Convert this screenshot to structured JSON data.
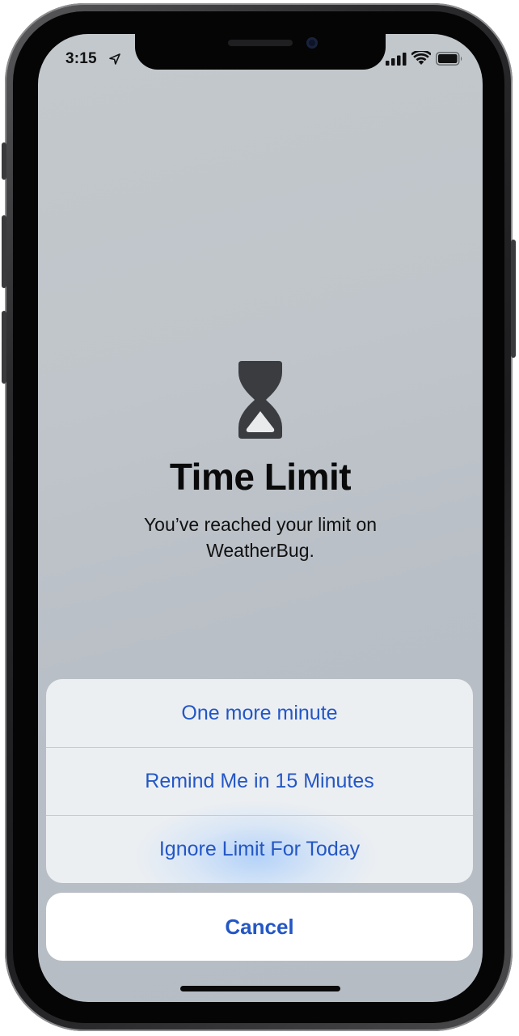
{
  "status_bar": {
    "time": "3:15",
    "location_icon": "location-arrow-icon",
    "signal_icon": "cellular-signal-icon",
    "wifi_icon": "wifi-icon",
    "battery_icon": "battery-icon"
  },
  "content": {
    "icon": "hourglass-icon",
    "title": "Time Limit",
    "message": "You’ve reached your limit on WeatherBug."
  },
  "action_sheet": {
    "actions": [
      {
        "label": "One more minute"
      },
      {
        "label": "Remind Me in 15 Minutes"
      },
      {
        "label": "Ignore Limit For Today"
      }
    ],
    "cancel_label": "Cancel"
  },
  "colors": {
    "accent": "#2457c5",
    "title_text": "#0a0a0a",
    "sheet_background": "#eef0f4",
    "screen_background": "#bfc5ca"
  }
}
